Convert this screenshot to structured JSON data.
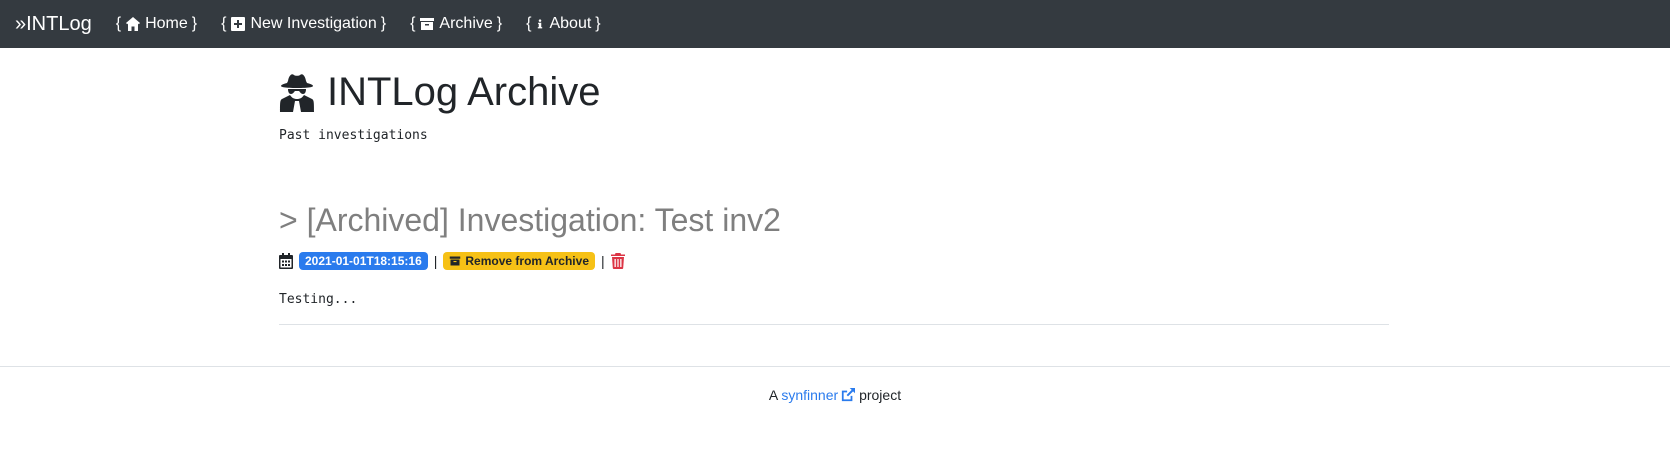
{
  "navbar": {
    "brand": "»INTLog",
    "items": [
      {
        "label_open": "{",
        "label": "Home",
        "label_close": "}",
        "icon": "home-icon"
      },
      {
        "label_open": "{",
        "label": "New Investigation",
        "label_close": "}",
        "icon": "plus-square-icon"
      },
      {
        "label_open": "{",
        "label": "Archive",
        "label_close": "}",
        "icon": "archive-icon"
      },
      {
        "label_open": "{",
        "label": "About",
        "label_close": "}",
        "icon": "info-icon"
      }
    ]
  },
  "page": {
    "title": "INTLog Archive",
    "subtitle": "Past investigations",
    "icon": "user-secret-icon"
  },
  "investigations": [
    {
      "title": "> [Archived] Investigation: Test inv2",
      "date": "2021-01-01T18:15:16",
      "remove_label": "Remove from Archive",
      "separator": "|",
      "description": "Testing..."
    }
  ],
  "footer": {
    "prefix": "A",
    "link": "synfinner",
    "suffix": "project"
  },
  "colors": {
    "navbar_bg": "#343a40",
    "date_badge": "#2a7bed",
    "archive_badge": "#f6c116",
    "trash": "#dc3545",
    "link": "#2a7bed"
  }
}
